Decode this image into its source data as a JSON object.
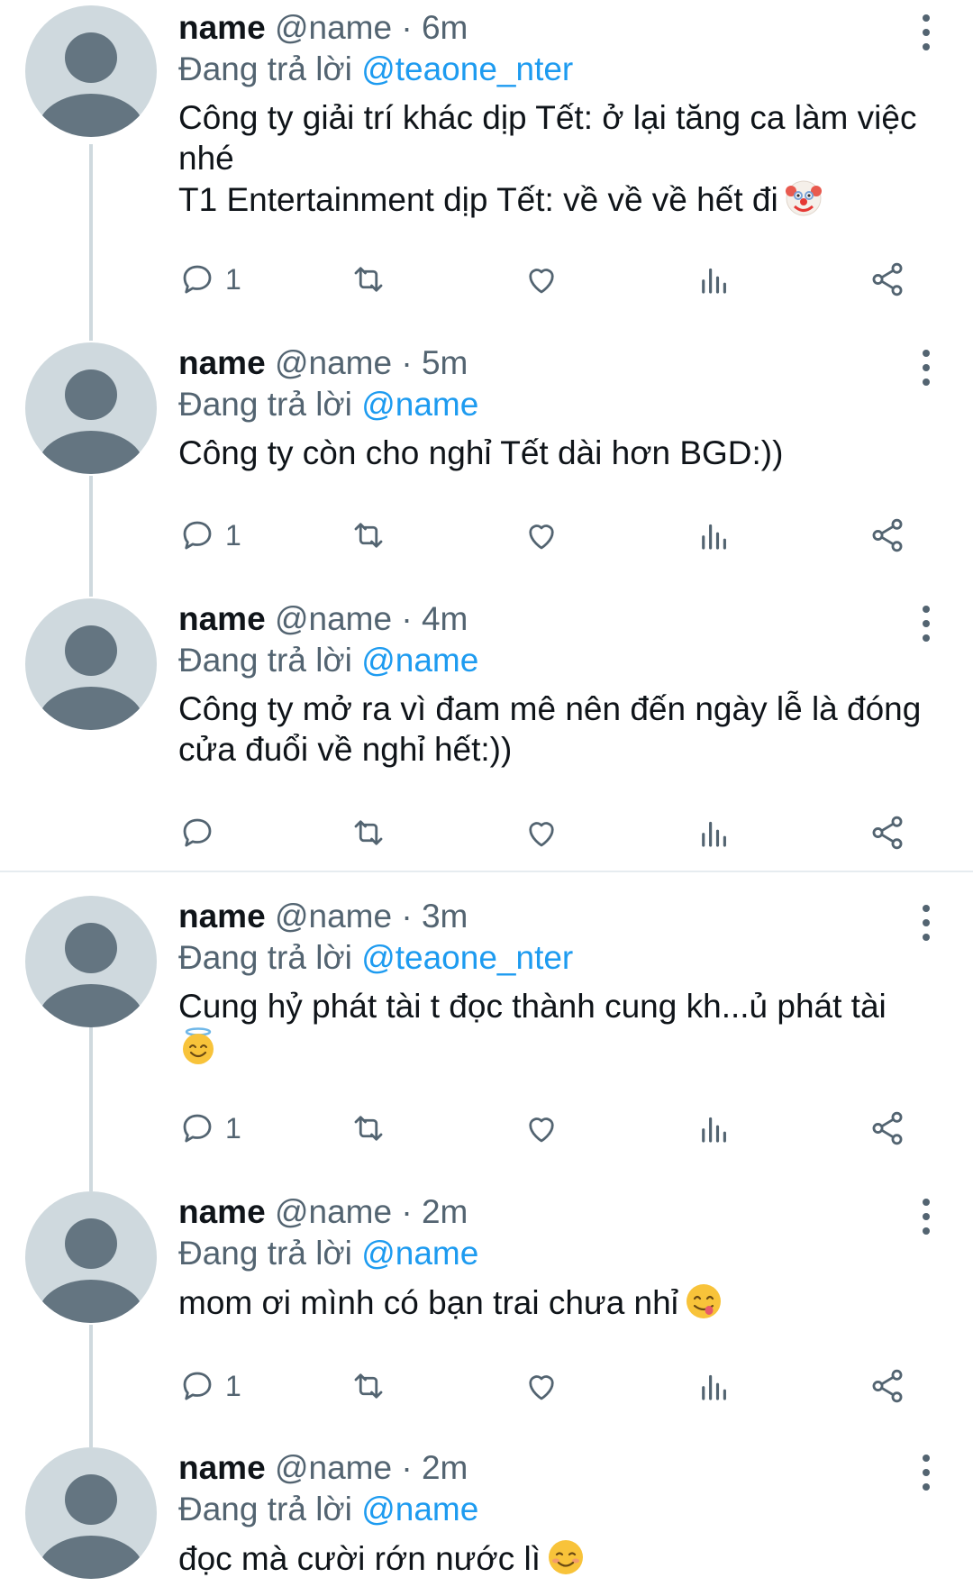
{
  "reply_prefix": "Đang trả lời",
  "tweets": [
    {
      "name": "name",
      "handle": "@name",
      "dot": "·",
      "time": "6m",
      "reply_to": "@teaone_nter",
      "lines": [
        "Công ty giải trí khác dịp Tết: ở lại tăng ca làm việc nhé",
        "T1 Entertainment dịp Tết: về về về hết đi"
      ],
      "emoji": "clown-face",
      "reply_count": "1"
    },
    {
      "name": "name",
      "handle": "@name",
      "dot": "·",
      "time": "5m",
      "reply_to": "@name",
      "lines": [
        "Công ty còn cho nghỉ Tết dài hơn BGD:))"
      ],
      "reply_count": "1"
    },
    {
      "name": "name",
      "handle": "@name",
      "dot": "·",
      "time": "4m",
      "reply_to": "@name",
      "lines": [
        "Công ty mở ra vì đam mê nên đến ngày lễ là đóng cửa đuổi về nghỉ hết:))"
      ],
      "reply_count": ""
    },
    {
      "name": "name",
      "handle": "@name",
      "dot": "·",
      "time": "3m",
      "reply_to": "@teaone_nter",
      "lines": [
        "Cung hỷ phát tài t đọc thành cung kh...ủ phát tài"
      ],
      "emoji": "smiling-face-with-halo",
      "reply_count": "1"
    },
    {
      "name": "name",
      "handle": "@name",
      "dot": "·",
      "time": "2m",
      "reply_to": "@name",
      "lines": [
        "mom ơi mình có bạn trai chưa nhỉ"
      ],
      "emoji": "face-savoring-food",
      "reply_count": "1"
    },
    {
      "name": "name",
      "handle": "@name",
      "dot": "·",
      "time": "2m",
      "reply_to": "@name",
      "lines": [
        "đọc mà cười rớn nước lì"
      ],
      "emoji": "smiling-face",
      "reply_count": ""
    }
  ],
  "icons": {
    "reply": "reply-icon",
    "retweet": "retweet-icon",
    "like": "heart-icon",
    "views": "views-icon",
    "share": "share-icon",
    "more": "more-icon"
  },
  "colors": {
    "mention": "#1d9bf0",
    "muted": "#536471",
    "avatar_bg": "#cfd9de",
    "avatar_fg": "#647581"
  }
}
